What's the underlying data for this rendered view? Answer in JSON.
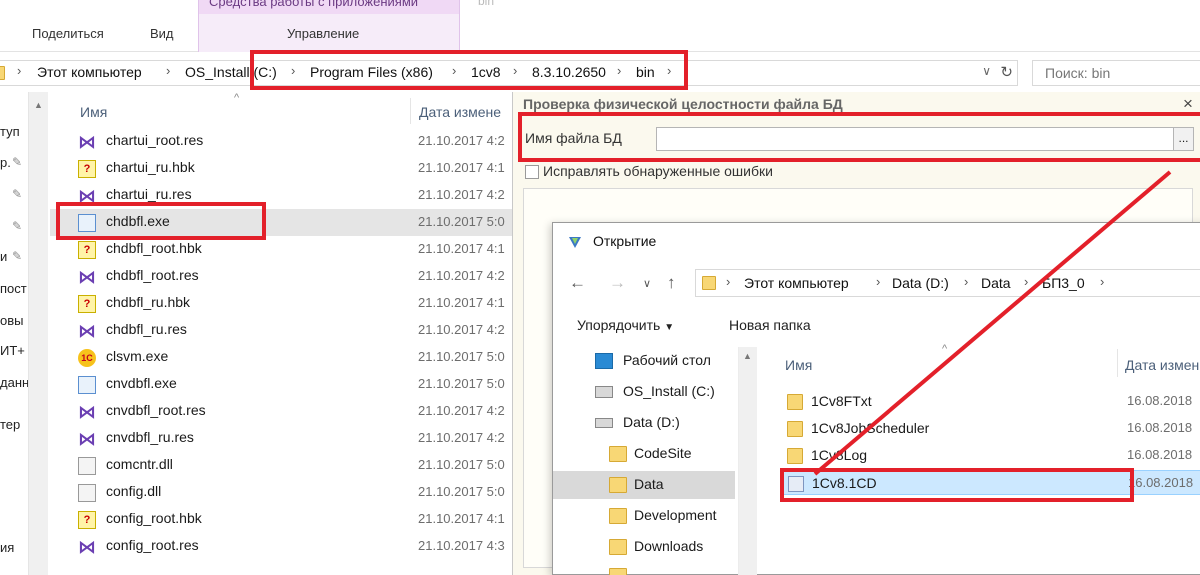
{
  "ribbon": {
    "tabs": [
      "Поделиться",
      "Вид"
    ],
    "context_group": "Средства работы с приложениями",
    "context_tab": "Управление",
    "context_tab2": "bin"
  },
  "address": {
    "crumbs": [
      "Этот компьютер",
      "OS_Install (C:)",
      "Program Files (x86)",
      "1cv8",
      "8.3.10.2650",
      "bin"
    ],
    "search_placeholder": "Поиск: bin"
  },
  "leftnav": {
    "items": [
      "туп",
      "р.",
      "",
      "",
      "и",
      "пост",
      "овы",
      "ИТ+",
      "данн",
      "тер",
      "",
      "",
      "ия"
    ]
  },
  "filelist": {
    "col_name": "Имя",
    "col_date": "Дата измене",
    "rows": [
      {
        "name": "chartui_root.res",
        "date": "21.10.2017 4:2",
        "icon": "vs-res-icon"
      },
      {
        "name": "chartui_ru.hbk",
        "date": "21.10.2017 4:1",
        "icon": "hbk-icon"
      },
      {
        "name": "chartui_ru.res",
        "date": "21.10.2017 4:2",
        "icon": "vs-res-icon"
      },
      {
        "name": "chdbfl.exe",
        "date": "21.10.2017 5:0",
        "icon": "exe-icon"
      },
      {
        "name": "chdbfl_root.hbk",
        "date": "21.10.2017 4:1",
        "icon": "hbk-icon"
      },
      {
        "name": "chdbfl_root.res",
        "date": "21.10.2017 4:2",
        "icon": "vs-res-icon"
      },
      {
        "name": "chdbfl_ru.hbk",
        "date": "21.10.2017 4:1",
        "icon": "hbk-icon"
      },
      {
        "name": "chdbfl_ru.res",
        "date": "21.10.2017 4:2",
        "icon": "vs-res-icon"
      },
      {
        "name": "clsvm.exe",
        "date": "21.10.2017 5:0",
        "icon": "1c-icon"
      },
      {
        "name": "cnvdbfl.exe",
        "date": "21.10.2017 5:0",
        "icon": "exe-icon"
      },
      {
        "name": "cnvdbfl_root.res",
        "date": "21.10.2017 4:2",
        "icon": "vs-res-icon"
      },
      {
        "name": "cnvdbfl_ru.res",
        "date": "21.10.2017 4:2",
        "icon": "vs-res-icon"
      },
      {
        "name": "comcntr.dll",
        "date": "21.10.2017 5:0",
        "icon": "dll-icon"
      },
      {
        "name": "config.dll",
        "date": "21.10.2017 5:0",
        "icon": "dll-icon"
      },
      {
        "name": "config_root.hbk",
        "date": "21.10.2017 4:1",
        "icon": "hbk-icon"
      },
      {
        "name": "config_root.res",
        "date": "21.10.2017 4:3",
        "icon": "vs-res-icon"
      }
    ]
  },
  "check_dialog": {
    "title": "Проверка физической целостности файла БД",
    "close": "×",
    "filename_label": "Имя файла БД",
    "filename_value": "",
    "browse": "...",
    "fix_errors_label": "Исправлять обнаруженные ошибки"
  },
  "open_dialog": {
    "title": "Открытие",
    "crumbs": [
      "Этот компьютер",
      "Data (D:)",
      "Data",
      "БП3_0"
    ],
    "organize": "Упорядочить",
    "new_folder": "Новая папка",
    "tree": [
      {
        "label": "Рабочий стол",
        "icon": "desktop-icon",
        "indent": 0
      },
      {
        "label": "OS_Install (C:)",
        "icon": "drive-icon",
        "indent": 0
      },
      {
        "label": "Data (D:)",
        "icon": "drive-icon",
        "indent": 0
      },
      {
        "label": "CodeSite",
        "icon": "folder-icon",
        "indent": 1
      },
      {
        "label": "Data",
        "icon": "folder-icon",
        "indent": 1
      },
      {
        "label": "Development",
        "icon": "folder-icon",
        "indent": 1
      },
      {
        "label": "Downloads",
        "icon": "folder-icon",
        "indent": 1
      }
    ],
    "col_name": "Имя",
    "col_date": "Дата измен",
    "files": [
      {
        "name": "1Cv8FTxt",
        "date": "16.08.2018",
        "icon": "folder-icon"
      },
      {
        "name": "1Cv8JobScheduler",
        "date": "16.08.2018",
        "icon": "folder-icon"
      },
      {
        "name": "1Cv8Log",
        "date": "16.08.2018",
        "icon": "folder-icon"
      },
      {
        "name": "1Cv8.1CD",
        "date": "16.08.2018",
        "icon": "database-file-icon"
      }
    ]
  },
  "colors": {
    "highlight": "#e3202a",
    "context_band": "#f0d9f5",
    "selection": "#cce8ff"
  }
}
